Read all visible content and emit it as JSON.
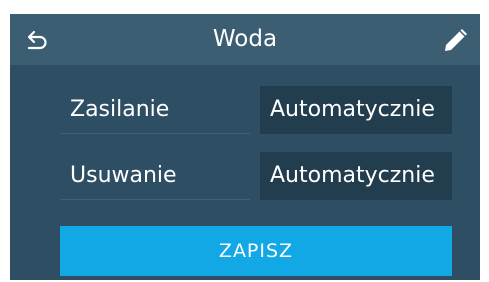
{
  "header": {
    "title": "Woda",
    "back_icon": "undo-arrow-icon",
    "edit_icon": "pencil-icon"
  },
  "settings": [
    {
      "label": "Zasilanie",
      "value": "Automatycznie"
    },
    {
      "label": "Usuwanie",
      "value": "Automatycznie"
    }
  ],
  "actions": {
    "save_label": "ZAPISZ"
  },
  "colors": {
    "background": "#2e4f63",
    "header": "#3b5e73",
    "value_field": "#223d4e",
    "accent": "#12a7e5",
    "text": "#ffffff"
  }
}
